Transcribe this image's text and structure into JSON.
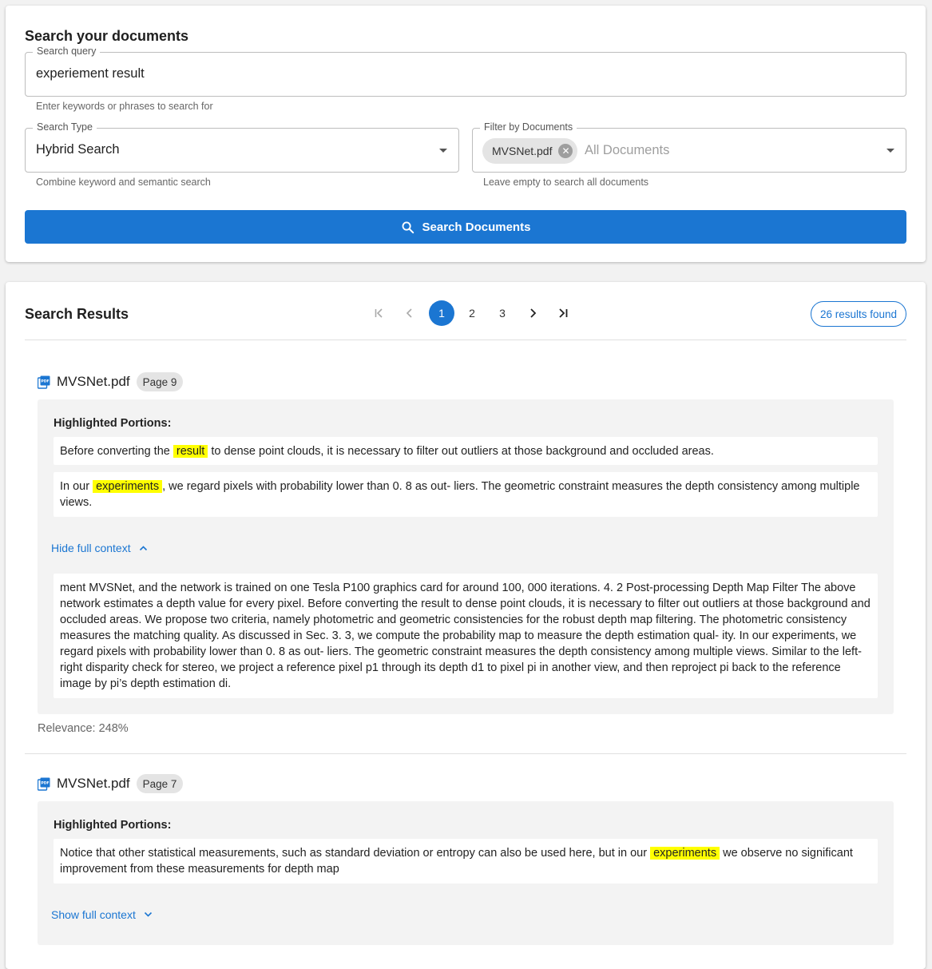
{
  "search_form": {
    "title": "Search your documents",
    "query": {
      "label": "Search query",
      "value": "experiement result",
      "helper": "Enter keywords or phrases to search for"
    },
    "search_type": {
      "label": "Search Type",
      "value": "Hybrid Search",
      "helper": "Combine keyword and semantic search"
    },
    "filter": {
      "label": "Filter by Documents",
      "chip": "MVSNet.pdf",
      "placeholder": "All Documents",
      "helper": "Leave empty to search all documents"
    },
    "submit_label": "Search Documents"
  },
  "results": {
    "title": "Search Results",
    "pagination": {
      "pages": [
        "1",
        "2",
        "3"
      ],
      "current": "1"
    },
    "count_label": "26 results found",
    "items": [
      {
        "file": "MVSNet.pdf",
        "page": "Page 9",
        "highlight_label": "Highlighted Portions:",
        "snippets": [
          {
            "before": "Before converting the ",
            "match": "result",
            "after": " to dense point clouds, it is necessary to filter out outliers at those background and occluded areas."
          },
          {
            "before": "In our ",
            "match": "experiments",
            "after": ", we regard pixels with probability lower than 0. 8 as out- liers. The geometric constraint measures the depth consistency among multiple views."
          }
        ],
        "toggle_label": "Hide full context",
        "context": "ment MVSNet, and the network is trained on one Tesla P100 graphics card for around 100, 000 iterations. 4. 2 Post-processing Depth Map Filter The above network estimates a depth value for every pixel. Before converting the result to dense point clouds, it is necessary to filter out outliers at those background and occluded areas. We propose two criteria, namely photometric and geometric consistencies for the robust depth map filtering. The photometric consistency measures the matching quality. As discussed in Sec. 3. 3, we compute the probability map to measure the depth estimation qual- ity. In our experiments, we regard pixels with probability lower than 0. 8 as out- liers. The geometric constraint measures the depth consistency among multiple views. Similar to the left-right disparity check for stereo, we project a reference pixel p1 through its depth d1 to pixel pi in another view, and then reproject pi back to the reference image by pi’s depth estimation di.",
        "relevance": "Relevance: 248%"
      },
      {
        "file": "MVSNet.pdf",
        "page": "Page 7",
        "highlight_label": "Highlighted Portions:",
        "snippets": [
          {
            "before": "Notice that other statistical measurements, such as standard deviation or entropy can also be used here, but in our ",
            "match": "experiments",
            "after": " we observe no significant improvement from these measurements for depth map"
          }
        ],
        "toggle_label": "Show full context"
      }
    ]
  },
  "colors": {
    "accent": "#1b76d2",
    "highlight": "#ffff00",
    "panel": "#f3f3f3"
  },
  "icons": [
    "search-icon",
    "chevron-down-icon",
    "close-circle-icon",
    "first-page-icon",
    "previous-page-icon",
    "next-page-icon",
    "last-page-icon",
    "pdf-file-icon",
    "chevron-up-icon"
  ]
}
